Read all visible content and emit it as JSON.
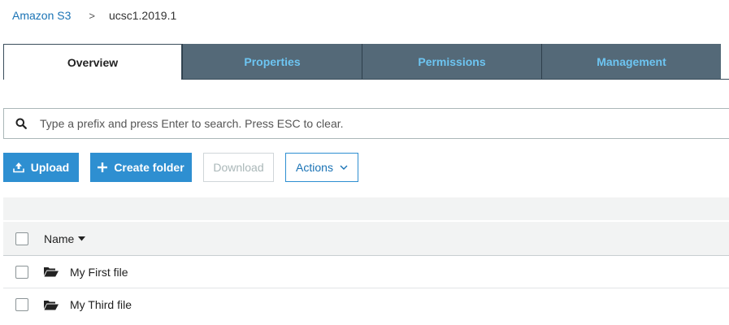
{
  "breadcrumb": {
    "root": "Amazon S3",
    "separator": ">",
    "current": "ucsc1.2019.1"
  },
  "tabs": [
    {
      "label": "Overview",
      "active": true
    },
    {
      "label": "Properties",
      "active": false
    },
    {
      "label": "Permissions",
      "active": false
    },
    {
      "label": "Management",
      "active": false
    }
  ],
  "search": {
    "placeholder": "Type a prefix and press Enter to search. Press ESC to clear.",
    "value": "",
    "icon": "search-icon"
  },
  "toolbar": {
    "upload_label": "Upload",
    "create_folder_label": "Create folder",
    "download_label": "Download",
    "actions_label": "Actions"
  },
  "table": {
    "name_header": "Name",
    "rows": [
      {
        "name": "My First file",
        "icon": "folder-open-icon"
      },
      {
        "name": "My Third file",
        "icon": "folder-open-icon"
      }
    ]
  },
  "colors": {
    "link": "#1a73b5",
    "tab_inactive_bg": "#546978",
    "tab_inactive_text": "#6dc5f2",
    "primary_button": "#2e8fd1",
    "disabled_text": "#aab7b8"
  }
}
